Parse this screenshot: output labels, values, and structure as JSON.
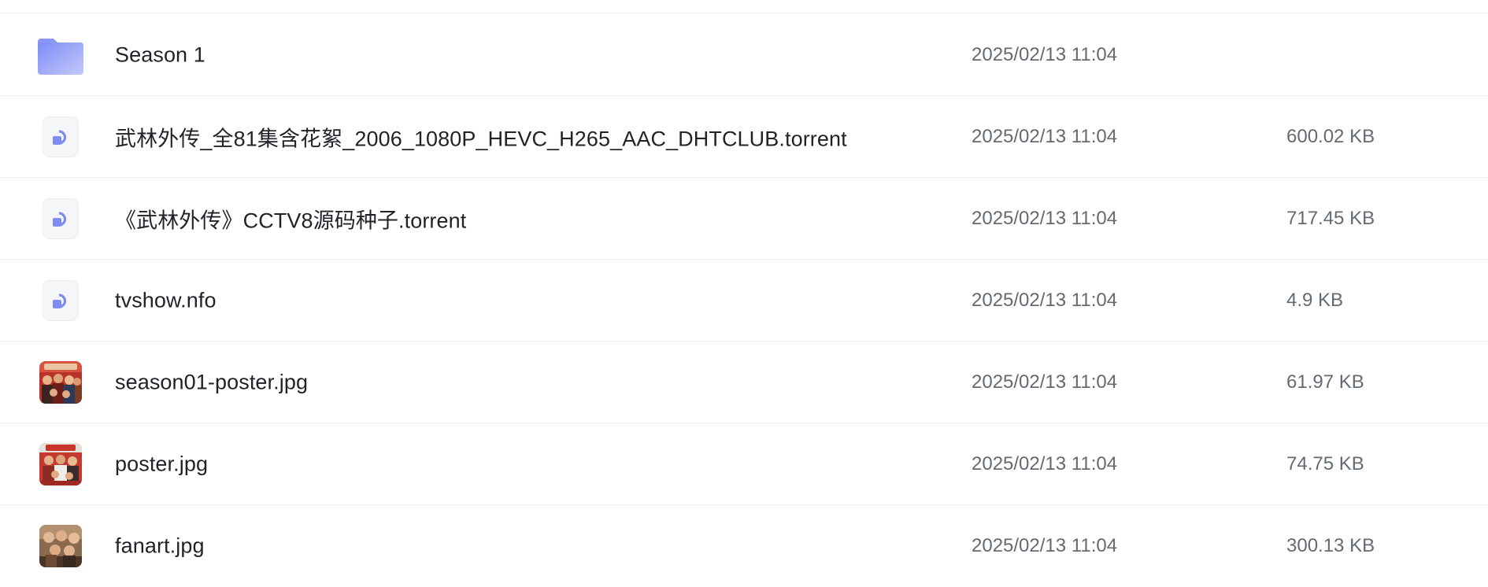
{
  "files": [
    {
      "type": "folder",
      "icon": "folder-icon",
      "name": "Season 1",
      "date": "2025/02/13 11:04",
      "size": ""
    },
    {
      "type": "file",
      "icon": "file-icon",
      "name": "武林外传_全81集含花絮_2006_1080P_HEVC_H265_AAC_DHTCLUB.torrent",
      "date": "2025/02/13 11:04",
      "size": "600.02 KB"
    },
    {
      "type": "file",
      "icon": "file-icon",
      "name": "《武林外传》CCTV8源码种子.torrent",
      "date": "2025/02/13 11:04",
      "size": "717.45 KB"
    },
    {
      "type": "file",
      "icon": "file-icon",
      "name": "tvshow.nfo",
      "date": "2025/02/13 11:04",
      "size": "4.9 KB"
    },
    {
      "type": "image",
      "icon": "image-thumbnail-icon",
      "name": "season01-poster.jpg",
      "date": "2025/02/13 11:04",
      "size": "61.97 KB"
    },
    {
      "type": "image",
      "icon": "image-thumbnail-icon",
      "name": "poster.jpg",
      "date": "2025/02/13 11:04",
      "size": "74.75 KB"
    },
    {
      "type": "image",
      "icon": "image-thumbnail-icon",
      "name": "fanart.jpg",
      "date": "2025/02/13 11:04",
      "size": "300.13 KB"
    }
  ],
  "colors": {
    "folder_start": "#7d8cf7",
    "folder_end": "#c3c9fb",
    "file_glyph": "#7c8cf5",
    "text_primary": "#1f2329",
    "text_secondary": "#646a73",
    "divider": "#eceef0"
  }
}
